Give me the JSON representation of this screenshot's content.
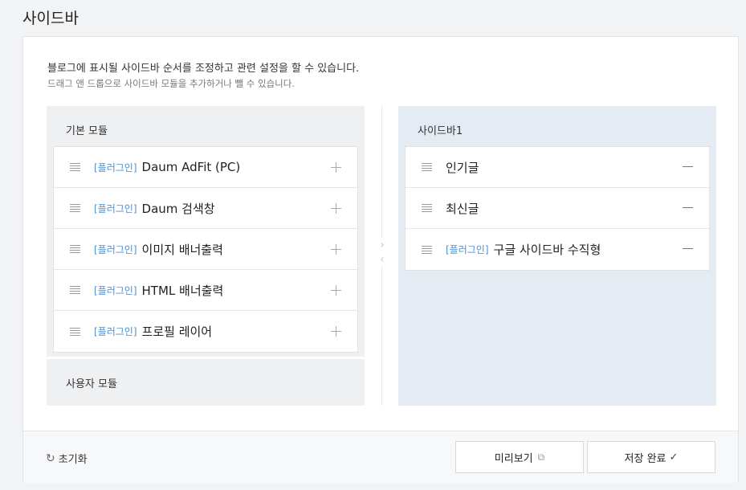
{
  "page": {
    "title": "사이드바"
  },
  "description": {
    "line1": "블로그에 표시될 사이드바 순서를 조정하고 관련 설정을 할 수 있습니다.",
    "line2": "드래그 앤 드롭으로 사이드바 모듈을 추가하거나 뺄 수 있습니다."
  },
  "basic_modules": {
    "title": "기본 모듈",
    "items": [
      {
        "tag": "[플러그인]",
        "label": "Daum AdFit (PC)"
      },
      {
        "tag": "[플러그인]",
        "label": "Daum 검색창"
      },
      {
        "tag": "[플러그인]",
        "label": "이미지 배너출력"
      },
      {
        "tag": "[플러그인]",
        "label": "HTML 배너출력"
      },
      {
        "tag": "[플러그인]",
        "label": "프로필 레이어"
      }
    ]
  },
  "user_modules": {
    "title": "사용자 모듈"
  },
  "sidebar1": {
    "title": "사이드바1",
    "items": [
      {
        "tag": "",
        "label": "인기글"
      },
      {
        "tag": "",
        "label": "최신글"
      },
      {
        "tag": "[플러그인]",
        "label": "구글 사이드바 수직형"
      }
    ]
  },
  "footer": {
    "reset_label": "초기화",
    "preview_label": "미리보기",
    "save_label": "저장 완료"
  },
  "icons": {
    "drag": "drag-handle-icon",
    "add": "plus-icon",
    "remove": "minus-icon",
    "move": "move-arrows-icon",
    "reset": "refresh-icon",
    "external": "external-link-icon",
    "check": "check-icon"
  },
  "colors": {
    "plugin_tag": "#4c8fd0",
    "sidebar_bg": "#e5ebf2",
    "module_bg": "#eff0f2"
  }
}
